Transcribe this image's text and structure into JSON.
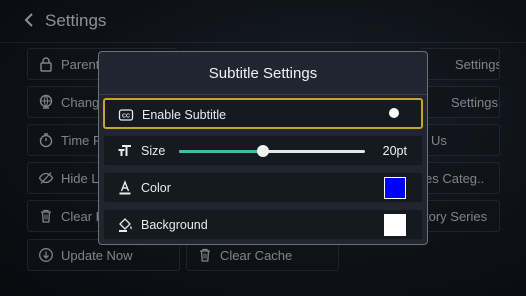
{
  "header": {
    "title": "Settings",
    "back_icon": "chevron-left-icon"
  },
  "tiles": [
    {
      "label": "Parent",
      "icon": "lock-icon"
    },
    {
      "label": "Settings",
      "icon": ""
    },
    {
      "label": "Chang",
      "icon": "globe-icon"
    },
    {
      "label": "Settings",
      "icon": ""
    },
    {
      "label": "Time F",
      "icon": "stopwatch-icon"
    },
    {
      "label": "Us",
      "icon": ""
    },
    {
      "label": "Hide Li",
      "icon": "eye-off-icon"
    },
    {
      "label": "es Categ..",
      "icon": ""
    },
    {
      "label": "Clear H",
      "icon": "trash-icon"
    },
    {
      "label": "tory Series",
      "icon": ""
    },
    {
      "label": "Update Now",
      "icon": "download-icon"
    },
    {
      "label": "Clear Cache",
      "icon": "trash-icon"
    }
  ],
  "dialog": {
    "title": "Subtitle Settings",
    "rows": [
      {
        "label": "Enable Subtitle",
        "icon": "closed-caption-icon",
        "enabled": true
      },
      {
        "label": "Size",
        "icon": "text-size-icon",
        "value": "20pt",
        "level": 0.45
      },
      {
        "label": "Color",
        "icon": "text-color-icon",
        "color": "#0000ff"
      },
      {
        "label": "Background",
        "icon": "paint-bucket-icon",
        "color": "#ffffff"
      }
    ]
  },
  "colors": {
    "focus": "#c8a233",
    "accent": "#3cbfa3"
  }
}
